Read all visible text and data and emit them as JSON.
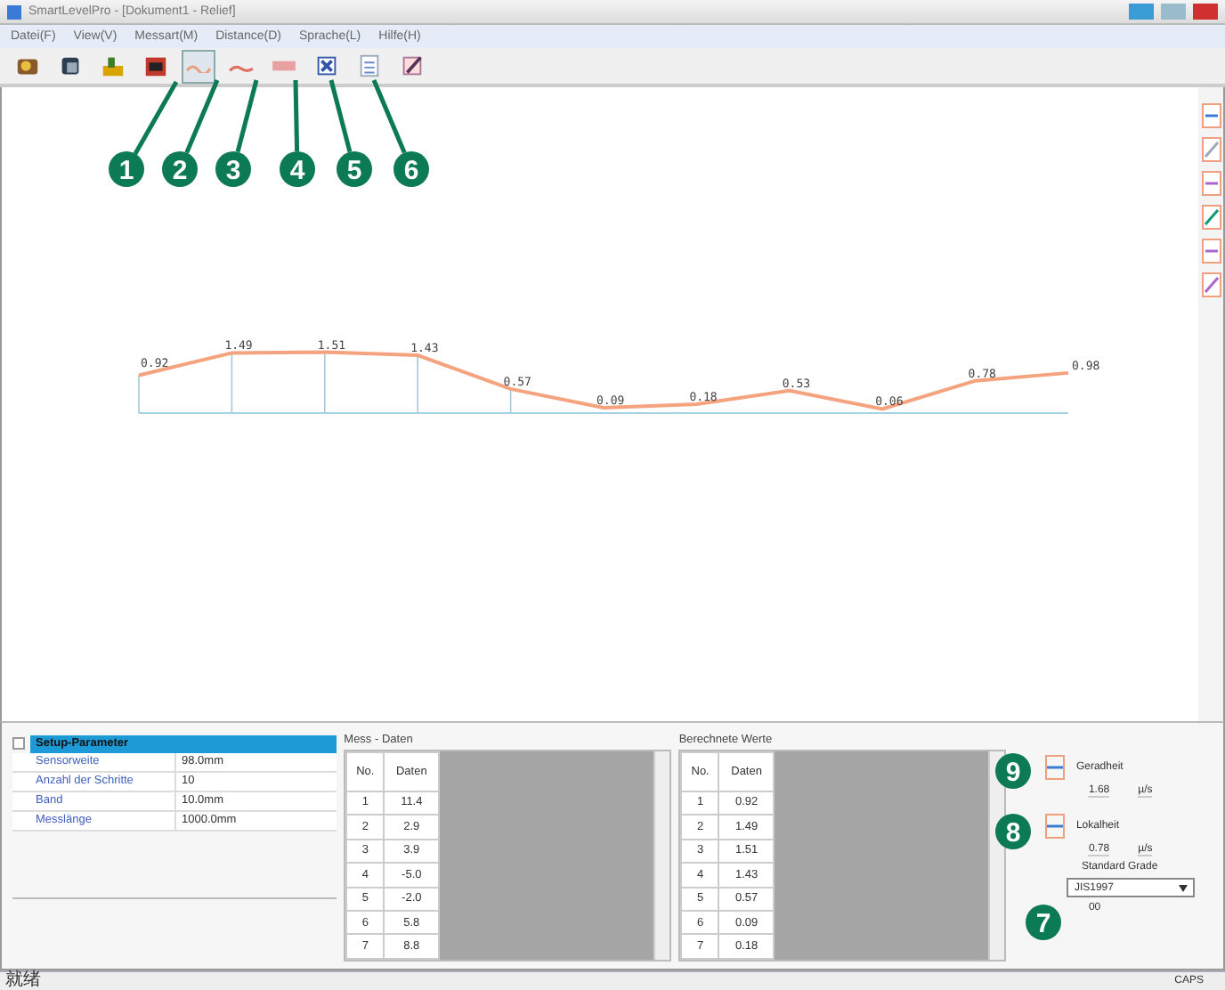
{
  "window": {
    "title": "SmartLevelPro - [Dokument1 - Relief]"
  },
  "menu": [
    "Datei(F)",
    "View(V)",
    "Messart(M)",
    "Distance(D)",
    "Sprache(L)",
    "Hilfe(H)"
  ],
  "toolbar": [
    {
      "selected": false
    },
    {
      "selected": false
    },
    {
      "selected": false
    },
    {
      "selected": false
    },
    {
      "selected": true
    },
    {
      "selected": false
    },
    {
      "selected": false
    },
    {
      "selected": false
    },
    {
      "selected": false
    },
    {
      "selected": false
    }
  ],
  "profile": {
    "chart_data": {
      "type": "line",
      "data_labels": true,
      "grid": true,
      "series": [
        {
          "color": "#f4a37e",
          "values": [
            0.92,
            1.49,
            1.51,
            1.43,
            0.57,
            0.09,
            0.18,
            0.53,
            0.06,
            0.78,
            0.98
          ]
        }
      ]
    },
    "labels": [
      "0.92",
      "1.49",
      "1.51",
      "1.43",
      "0.57",
      "0.09",
      "0.18",
      "0.53",
      "0.06",
      "0.78",
      "0.98"
    ]
  },
  "callouts": [
    {
      "label": "1"
    },
    {
      "label": "2"
    },
    {
      "label": "3"
    },
    {
      "label": "4"
    },
    {
      "label": "5"
    },
    {
      "label": "6"
    },
    {
      "label": "7"
    },
    {
      "label": "8"
    },
    {
      "label": "9"
    }
  ],
  "setup": {
    "title": "Setup-Parameter",
    "expanded": true,
    "rows": [
      {
        "name": "Sensorweite",
        "value": "98.0mm"
      },
      {
        "name": "Anzahl der Schritte",
        "value": "10"
      },
      {
        "name": "Band",
        "value": "10.0mm"
      },
      {
        "name": "Messlänge",
        "value": "1000.0mm"
      }
    ]
  },
  "measured": {
    "title": "Mess - Daten",
    "columns": [
      "No.",
      "Daten"
    ],
    "rows": [
      [
        "1",
        "11.4"
      ],
      [
        "2",
        "2.9"
      ],
      [
        "3",
        "3.9"
      ],
      [
        "4",
        "-5.0"
      ],
      [
        "5",
        "-2.0"
      ],
      [
        "6",
        "5.8"
      ],
      [
        "7",
        "8.8"
      ]
    ]
  },
  "computed": {
    "title": "Berechnete Werte",
    "columns": [
      "No.",
      "Daten"
    ],
    "rows": [
      [
        "1",
        "0.92"
      ],
      [
        "2",
        "1.49"
      ],
      [
        "3",
        "1.51"
      ],
      [
        "4",
        "1.43"
      ],
      [
        "5",
        "0.57"
      ],
      [
        "6",
        "0.09"
      ],
      [
        "7",
        "0.18"
      ]
    ]
  },
  "results": [
    {
      "label": "Geradheit",
      "value": "1.68",
      "unit": "µ/s"
    },
    {
      "label": "Lokalheit",
      "value": "0.78",
      "unit": "µ/s"
    }
  ],
  "standard": {
    "label": "Standard Grade",
    "value": "JIS1997",
    "note": "00"
  },
  "status_bar": {
    "left": "就绪",
    "right": "CAPS"
  }
}
